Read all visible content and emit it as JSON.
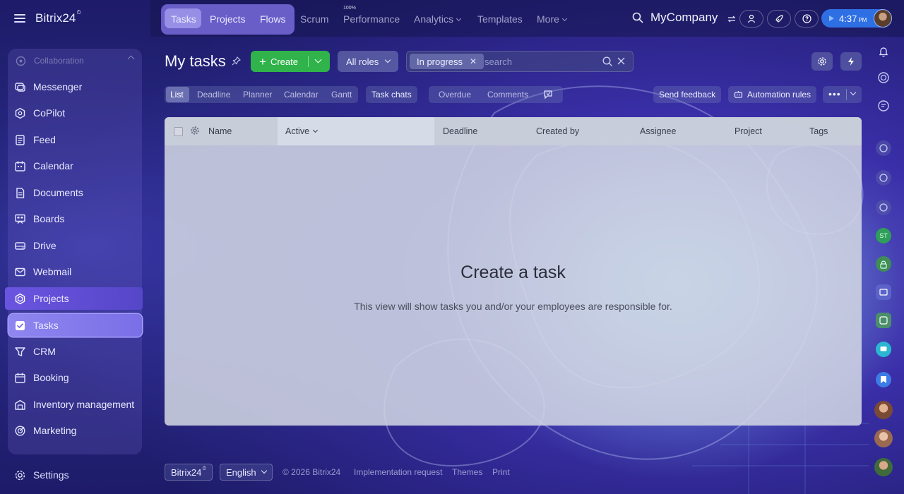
{
  "app": {
    "brand": "Bitrix24",
    "brand_mark": "⏱"
  },
  "sidebar": {
    "section": "Collaboration",
    "items": [
      {
        "label": "Messenger",
        "icon": "messenger-icon"
      },
      {
        "label": "CoPilot",
        "icon": "copilot-icon"
      },
      {
        "label": "Feed",
        "icon": "feed-icon"
      },
      {
        "label": "Calendar",
        "icon": "calendar-icon"
      },
      {
        "label": "Documents",
        "icon": "documents-icon"
      },
      {
        "label": "Boards",
        "icon": "boards-icon"
      },
      {
        "label": "Drive",
        "icon": "drive-icon"
      },
      {
        "label": "Webmail",
        "icon": "webmail-icon"
      },
      {
        "label": "Projects",
        "icon": "projects-icon"
      },
      {
        "label": "Tasks",
        "icon": "tasks-icon"
      },
      {
        "label": "CRM",
        "icon": "crm-icon"
      },
      {
        "label": "Booking",
        "icon": "booking-icon"
      },
      {
        "label": "Inventory management",
        "icon": "inventory-icon"
      },
      {
        "label": "Marketing",
        "icon": "marketing-icon"
      }
    ],
    "settings": "Settings"
  },
  "topnav": {
    "items": [
      "Tasks",
      "Projects",
      "Flows",
      "Scrum",
      "Performance",
      "Analytics",
      "Templates",
      "More"
    ],
    "performance_badge": "100%",
    "company": "MyCompany",
    "time": "4:37",
    "time_suffix": "PM"
  },
  "page": {
    "title": "My tasks",
    "create_label": "Create",
    "roles_label": "All roles",
    "filter_chip": "In progress",
    "search_placeholder": "search"
  },
  "views": {
    "tabs": [
      "List",
      "Deadline",
      "Planner",
      "Calendar",
      "Gantt"
    ],
    "task_chats": "Task chats",
    "overdue": "Overdue",
    "comments": "Comments",
    "send_feedback": "Send feedback",
    "automation_rules": "Automation rules"
  },
  "table": {
    "columns": [
      "Name",
      "Active",
      "Deadline",
      "Created by",
      "Assignee",
      "Project",
      "Tags"
    ]
  },
  "empty_state": {
    "title": "Create a task",
    "subtitle": "This view will show tasks you and/or your employees are responsible for."
  },
  "footer": {
    "brand": "Bitrix24",
    "language": "English",
    "copyright": "© 2026 Bitrix24",
    "links": [
      "Implementation request",
      "Themes",
      "Print"
    ]
  },
  "colors": {
    "accent_green": "#2fb34a",
    "accent_purple": "#7a6fe6",
    "time_blue": "#2f6fe4"
  }
}
